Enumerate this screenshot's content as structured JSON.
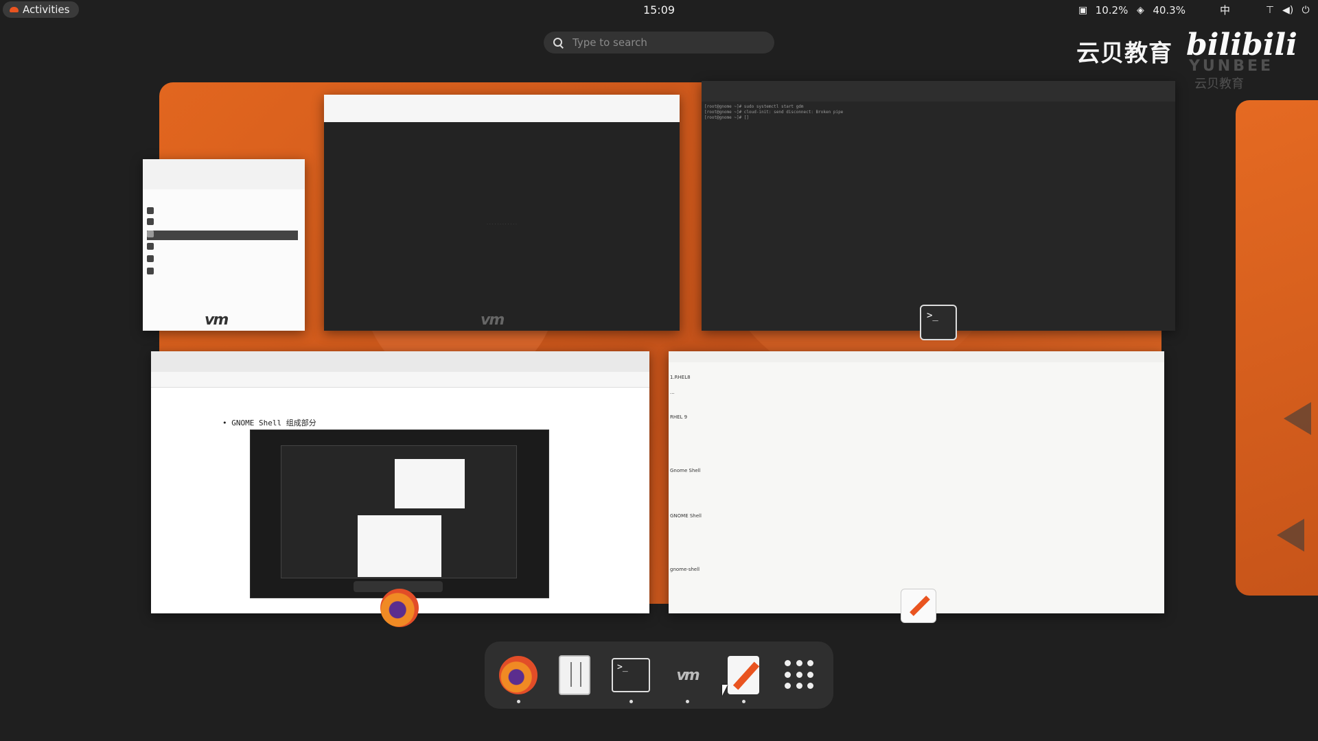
{
  "topbar": {
    "activities_label": "Activities",
    "clock": "15:09",
    "cpu": "10.2%",
    "mem": "40.3%",
    "input_method": "中",
    "icons": [
      "cpu-icon",
      "memory-icon",
      "network-icon",
      "volume-icon",
      "power-icon"
    ]
  },
  "search": {
    "placeholder": "Type to search"
  },
  "watermark": {
    "cn": "云贝教育",
    "brand": "bilibili",
    "en": "YUNBEE",
    "cn_small": "云贝教育"
  },
  "windows": {
    "browser": {
      "heading": "• GNOME Shell 组成部分"
    },
    "terminal": {
      "lines": [
        "[root@gnome ~]# sudo systemctl start gdm",
        "[root@gnome ~]# cloud-init: send disconnect: Broken pipe",
        "[root@gnome ~]# []"
      ]
    },
    "editor": {
      "lines": [
        "1.RHEL8",
        "...",
        "RHEL 9",
        "Gnome Shell",
        "GNOME Shell",
        "gnome-shell"
      ]
    }
  },
  "dock": {
    "items": [
      {
        "name": "firefox",
        "running": true
      },
      {
        "name": "files",
        "running": false
      },
      {
        "name": "terminal",
        "running": true
      },
      {
        "name": "virt-manager",
        "running": true
      },
      {
        "name": "text-editor",
        "running": true
      },
      {
        "name": "show-apps",
        "running": false
      }
    ]
  },
  "colors": {
    "accent": "#e95420",
    "panel": "#1f1f1f",
    "dock": "#2f2f2f"
  }
}
